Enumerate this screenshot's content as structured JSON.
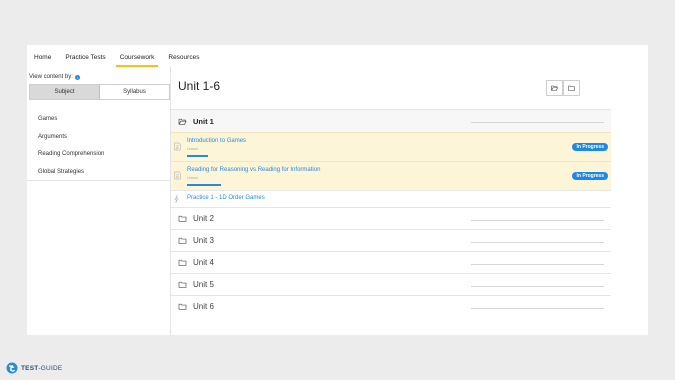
{
  "nav": {
    "tabs": [
      {
        "label": "Home"
      },
      {
        "label": "Practice Tests"
      },
      {
        "label": "Coursework",
        "active": true
      },
      {
        "label": "Resources"
      }
    ]
  },
  "sidebar": {
    "view_by_label": "View content by:",
    "info_icon": "i",
    "toggle": {
      "subject": "Subject",
      "syllabus": "Syllabus",
      "active": "Subject"
    },
    "items": [
      {
        "label": "Games"
      },
      {
        "label": "Arguments"
      },
      {
        "label": "Reading Comprehension"
      },
      {
        "label": "Global Strategies"
      }
    ]
  },
  "main": {
    "title": "Unit 1-6",
    "units": [
      {
        "label": "Unit 1",
        "open": true
      },
      {
        "label": "Unit 2"
      },
      {
        "label": "Unit 3"
      },
      {
        "label": "Unit 4"
      },
      {
        "label": "Unit 5"
      },
      {
        "label": "Unit 6"
      }
    ],
    "lessons": [
      {
        "title": "Introduction to Games",
        "type": "Lesson",
        "status": "In Progress"
      },
      {
        "title": "Reading for Reasoning vs Reading for Information",
        "type": "Lesson",
        "status": "In Progress"
      }
    ],
    "practice": {
      "label": "Practice 1 - 1D Order Games"
    }
  },
  "footer": {
    "brand_bold": "TEST",
    "brand_light": "GUIDE",
    "separator": "-"
  },
  "colors": {
    "accent": "#f0c419",
    "link": "#2a8ad8",
    "badge": "#1e88e5",
    "lesson_bg": "#fdf5d8"
  }
}
